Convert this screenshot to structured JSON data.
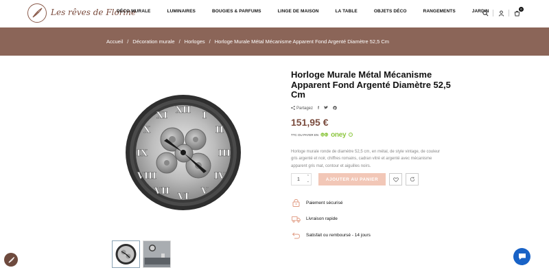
{
  "brand": {
    "name": "Les rêves de Florine"
  },
  "nav": {
    "items": [
      "DÉCO MURALE",
      "LUMINAIRES",
      "BOUGIES & PARFUMS",
      "LINGE DE MAISON",
      "LA TABLE",
      "OBJETS DÉCO",
      "RANGEMENTS",
      "JARDIN"
    ]
  },
  "header": {
    "cart_count": "0"
  },
  "breadcrumb": {
    "items": [
      "Accueil",
      "Décoration murale",
      "Horloges",
      "Horloge Murale Métal Mécanisme Apparent Fond Argenté Diamètre 52,5 Cm"
    ],
    "separator": "/"
  },
  "product": {
    "title": "Horloge Murale Métal Mécanisme Apparent Fond Argenté Diamètre 52,5 Cm",
    "share_label": "Partagez",
    "price": "151,95 €",
    "payment_prefix": "TTC OU PAYER EN",
    "oney_label": "oney",
    "description": "Horloge murale ronde de diamètre 52,5 cm, en métal, de style vintage, de couleur gris argenté et noir, chiffres romains, cadran vitré et argenté avec mécanisme apparent gris mat, contour et aiguilles noirs.",
    "quantity": "1",
    "add_to_cart": "AJOUTER AU PANIER"
  },
  "features": [
    {
      "icon": "lock-icon",
      "label": "Paiement sécurisé"
    },
    {
      "icon": "truck-icon",
      "label": "Livraison rapide"
    },
    {
      "icon": "return-icon",
      "label": "Satisfait ou remboursé - 14 jours"
    }
  ],
  "colors": {
    "accent_brown": "#8b6558",
    "price": "#7a4b3d",
    "add_to_cart": "#f2c7b7",
    "chat": "#1862c6",
    "oney": "#8cc63f"
  }
}
